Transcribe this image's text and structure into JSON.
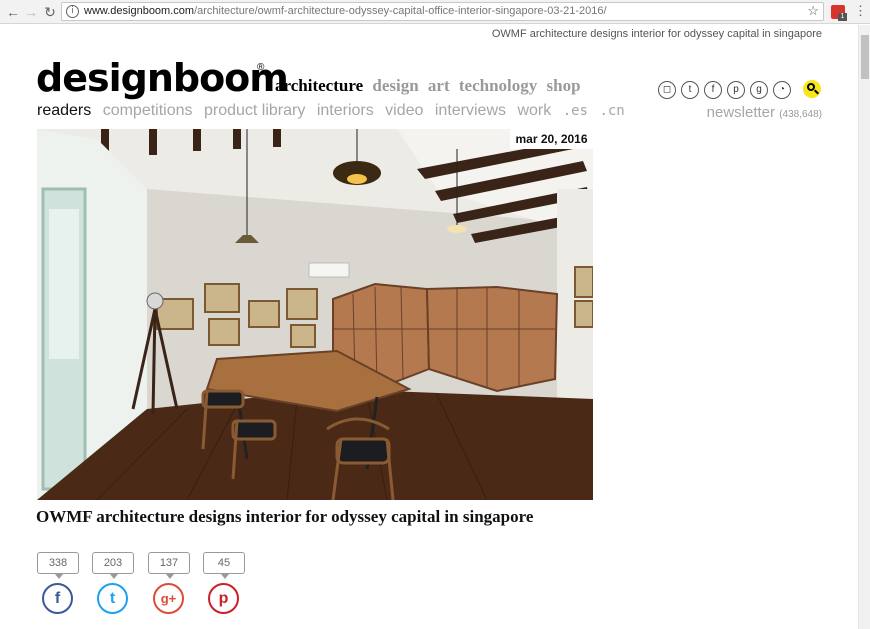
{
  "browser": {
    "url_host": "www.designboom.com",
    "url_path": "/architecture/owmf-architecture-odyssey-capital-office-interior-singapore-03-21-2016/",
    "ext_badge": "1"
  },
  "header": {
    "subtitle": "OWMF architecture designs interior for odyssey capital in singapore",
    "logo": "designboom",
    "logo_mark": "®",
    "main_nav": [
      "architecture",
      "design",
      "art",
      "technology",
      "shop"
    ],
    "sub_nav": [
      "readers",
      "competitions",
      "product library",
      "interiors",
      "video",
      "interviews",
      "work",
      ".es",
      ".cn"
    ],
    "newsletter_label": "newsletter",
    "newsletter_count": "(438,648)",
    "social_icons": [
      "instagram-icon",
      "twitter-icon",
      "facebook-icon",
      "pinterest-icon",
      "googleplus-icon",
      "rss-icon"
    ]
  },
  "article": {
    "date": "mar 20, 2016",
    "title": "OWMF architecture designs interior for odyssey capital in singapore",
    "shares": [
      {
        "network": "facebook",
        "count": "338",
        "glyph": "f",
        "color": "#3b5998"
      },
      {
        "network": "twitter",
        "count": "203",
        "glyph": "t",
        "color": "#1da1f2"
      },
      {
        "network": "googleplus",
        "count": "137",
        "glyph": "g+",
        "color": "#dd4b39"
      },
      {
        "network": "pinterest",
        "count": "45",
        "glyph": "p",
        "color": "#cb2027"
      }
    ]
  }
}
